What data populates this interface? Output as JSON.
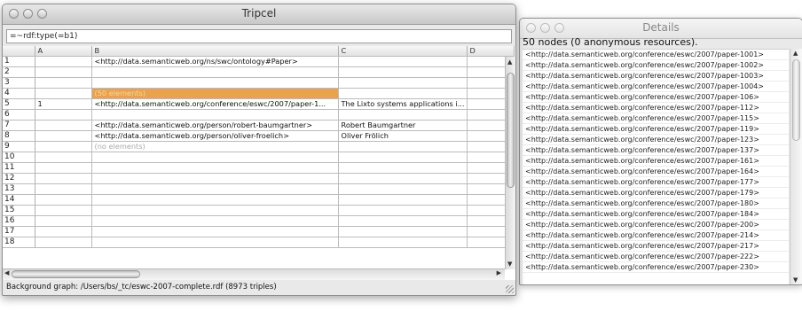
{
  "tripcel": {
    "title": "Tripcel",
    "formula": "=~rdf:type(=b1)",
    "columns": [
      "A",
      "B",
      "C",
      "D"
    ],
    "rows": [
      {
        "n": "1",
        "a": "",
        "b": "<http://data.semanticweb.org/ns/swc/ontology#Paper>",
        "c": "",
        "d": ""
      },
      {
        "n": "2",
        "a": "",
        "b": "",
        "c": "",
        "d": ""
      },
      {
        "n": "3",
        "a": "",
        "b": "",
        "c": "",
        "d": ""
      },
      {
        "n": "4",
        "a": "",
        "b": "(50 elements)",
        "c": "",
        "d": ""
      },
      {
        "n": "5",
        "a": "1",
        "b": "<http://data.semanticweb.org/conference/eswc/2007/paper-1...",
        "c": "The Lixto systems applications i...",
        "d": ""
      },
      {
        "n": "6",
        "a": "",
        "b": "",
        "c": "",
        "d": ""
      },
      {
        "n": "7",
        "a": "",
        "b": "<http://data.semanticweb.org/person/robert-baumgartner>",
        "c": "Robert Baumgartner",
        "d": ""
      },
      {
        "n": "8",
        "a": "",
        "b": "<http://data.semanticweb.org/person/oliver-froelich>",
        "c": "Oliver Frölich",
        "d": ""
      },
      {
        "n": "9",
        "a": "",
        "b": "(no elements)",
        "c": "",
        "d": ""
      },
      {
        "n": "10",
        "a": "",
        "b": "",
        "c": "",
        "d": ""
      },
      {
        "n": "11",
        "a": "",
        "b": "",
        "c": "",
        "d": ""
      },
      {
        "n": "12",
        "a": "",
        "b": "",
        "c": "",
        "d": ""
      },
      {
        "n": "13",
        "a": "",
        "b": "",
        "c": "",
        "d": ""
      },
      {
        "n": "14",
        "a": "",
        "b": "",
        "c": "",
        "d": ""
      },
      {
        "n": "15",
        "a": "",
        "b": "",
        "c": "",
        "d": ""
      },
      {
        "n": "16",
        "a": "",
        "b": "",
        "c": "",
        "d": ""
      },
      {
        "n": "17",
        "a": "",
        "b": "",
        "c": "",
        "d": ""
      },
      {
        "n": "18",
        "a": "",
        "b": "",
        "c": "",
        "d": ""
      }
    ],
    "status": "Background graph: /Users/bs/_tc/eswc-2007-complete.rdf (8973 triples)"
  },
  "details": {
    "title": "Details",
    "summary": "50 nodes (0 anonymous resources).",
    "items": [
      "<http://data.semanticweb.org/conference/eswc/2007/paper-1001>",
      "<http://data.semanticweb.org/conference/eswc/2007/paper-1002>",
      "<http://data.semanticweb.org/conference/eswc/2007/paper-1003>",
      "<http://data.semanticweb.org/conference/eswc/2007/paper-1004>",
      "<http://data.semanticweb.org/conference/eswc/2007/paper-106>",
      "<http://data.semanticweb.org/conference/eswc/2007/paper-112>",
      "<http://data.semanticweb.org/conference/eswc/2007/paper-115>",
      "<http://data.semanticweb.org/conference/eswc/2007/paper-119>",
      "<http://data.semanticweb.org/conference/eswc/2007/paper-123>",
      "<http://data.semanticweb.org/conference/eswc/2007/paper-137>",
      "<http://data.semanticweb.org/conference/eswc/2007/paper-161>",
      "<http://data.semanticweb.org/conference/eswc/2007/paper-164>",
      "<http://data.semanticweb.org/conference/eswc/2007/paper-177>",
      "<http://data.semanticweb.org/conference/eswc/2007/paper-179>",
      "<http://data.semanticweb.org/conference/eswc/2007/paper-180>",
      "<http://data.semanticweb.org/conference/eswc/2007/paper-184>",
      "<http://data.semanticweb.org/conference/eswc/2007/paper-200>",
      "<http://data.semanticweb.org/conference/eswc/2007/paper-214>",
      "<http://data.semanticweb.org/conference/eswc/2007/paper-217>",
      "<http://data.semanticweb.org/conference/eswc/2007/paper-222>",
      "<http://data.semanticweb.org/conference/eswc/2007/paper-230>"
    ]
  },
  "icons": {
    "scroll_up": "▲",
    "scroll_down": "▼",
    "scroll_left": "◀",
    "scroll_right": "▶"
  },
  "colors": {
    "selection": "#e9a24d"
  }
}
